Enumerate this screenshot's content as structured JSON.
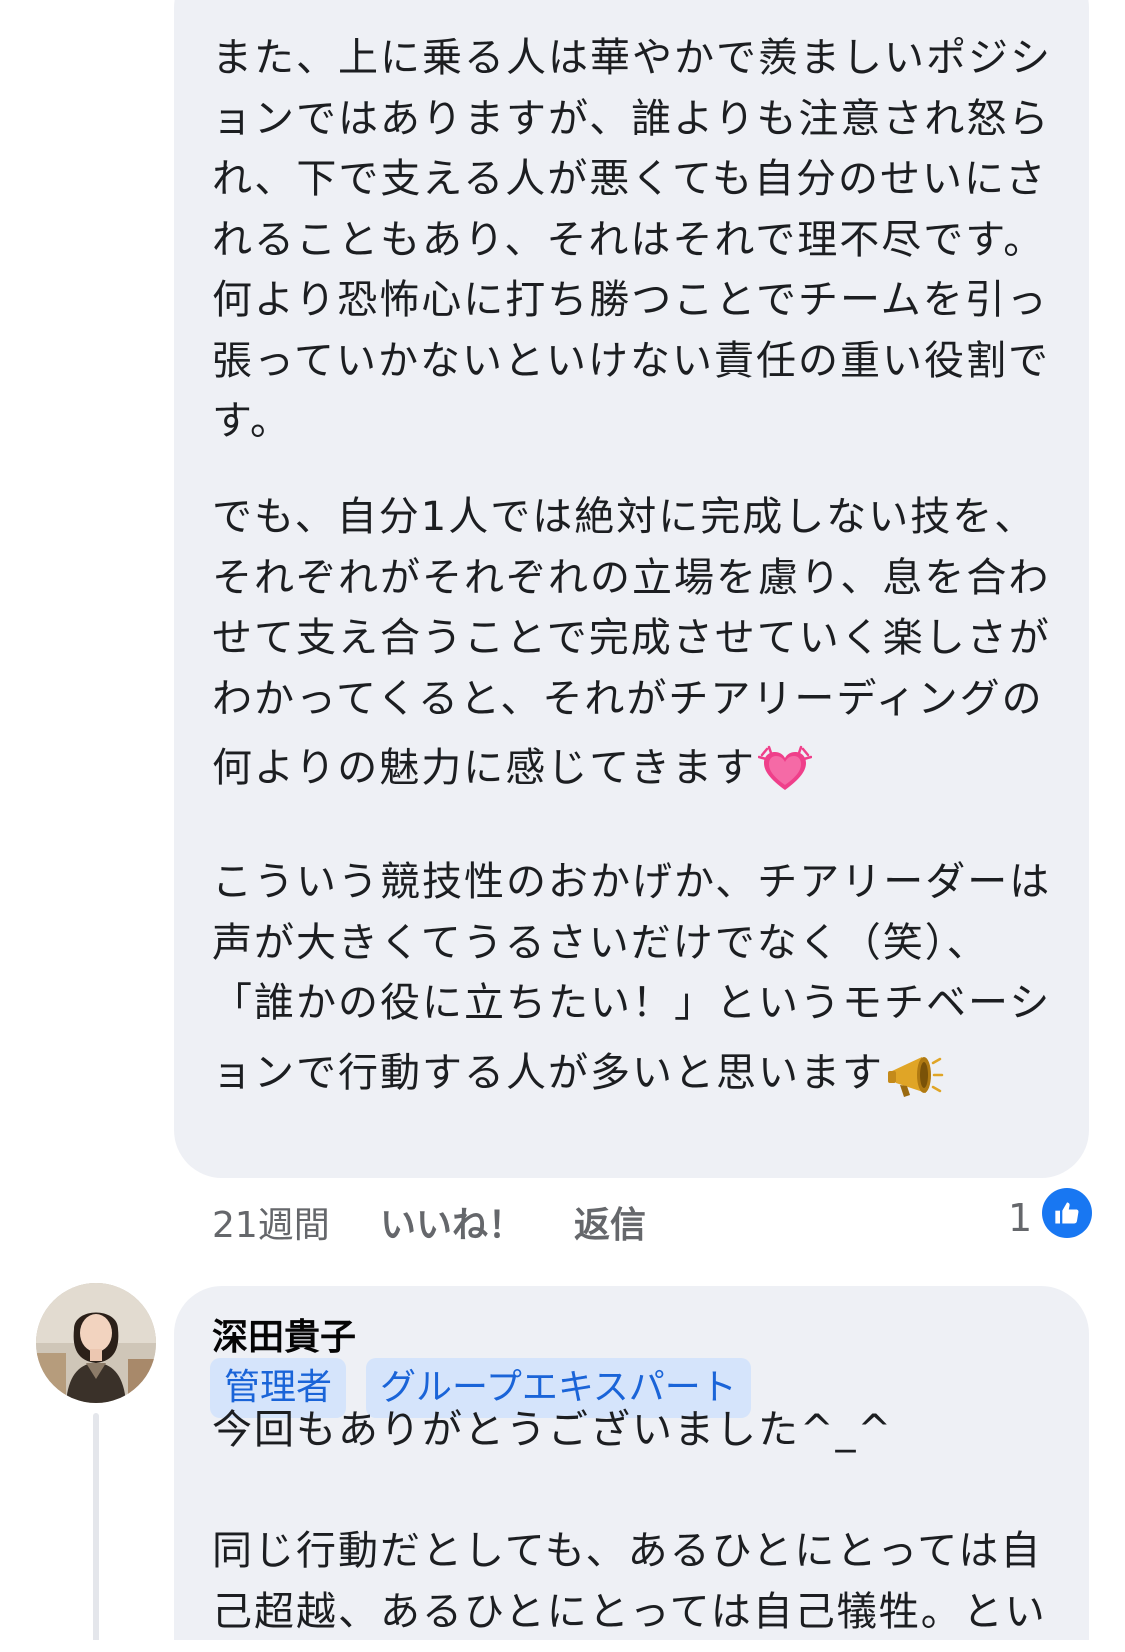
{
  "comment1": {
    "paragraph1": [
      "また、上に乗る人は華やかで羨ましいポジシ",
      "ョンではありますが、誰よりも注意され怒ら",
      "れ、下で支える人が悪くても自分のせいにさ",
      "れることもあり、それはそれで理不尽です。",
      "何より恐怖心に打ち勝つことでチームを引っ",
      "張っていかないといけない責任の重い役割で",
      "す。"
    ],
    "paragraph2": [
      "でも、自分1人では絶対に完成しない技を、",
      "それぞれがそれぞれの立場を慮り、息を合わ",
      "せて支え合うことで完成させていく楽しさが",
      "わかってくると、それがチアリーディングの",
      "何よりの魅力に感じてきます"
    ],
    "paragraph3": [
      "こういう競技性のおかげか、チアリーダーは",
      "声が大きくてうるさいだけでなく（笑）、",
      "「誰かの役に立ちたい！」というモチベーシ",
      "ョンで行動する人が多いと思います"
    ],
    "emoji_heart": "growing-heart-icon",
    "emoji_horn": "megaphone-icon",
    "meta": {
      "time": "21週間",
      "like_label": "いいね！",
      "reply_label": "返信",
      "like_count": "1"
    }
  },
  "comment2": {
    "author": "深田貴子",
    "badges": [
      "管理者",
      "グループエキスパート"
    ],
    "lines": [
      "今回もありがとうございました^_^",
      "",
      "同じ行動だとしても、あるひとにとっては自",
      "己超越、あるひとにとっては自己犠牲。とい"
    ]
  },
  "colors": {
    "bubble": "#eef0f5",
    "badge_bg": "#d5e4fb",
    "badge_text": "#1a64d8",
    "like_blue": "#1877f2",
    "meta_gray": "#65676b"
  }
}
